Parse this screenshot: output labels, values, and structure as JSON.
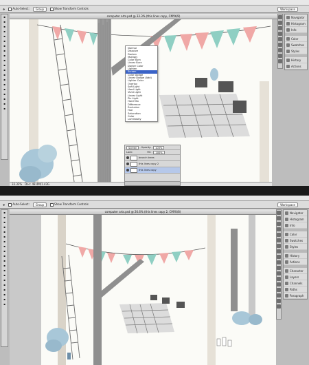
{
  "top": {
    "options_bar": {
      "auto_select_label": "Auto-Select:",
      "auto_select_value": "Group",
      "transform_label": "Show Transform Controls",
      "workspace_label": "Workspace"
    },
    "doc_title": "computer arts.psd @ 33.3% (this lines copy, CMYK/8)",
    "status_zoom": "33.33%",
    "status_doc": "Doc: 48.4M/1.43G",
    "blend_modes": [
      {
        "label": "Normal"
      },
      {
        "label": "Dissolve"
      },
      {
        "gap": true
      },
      {
        "label": "Darken"
      },
      {
        "label": "Multiply"
      },
      {
        "label": "Color Burn"
      },
      {
        "label": "Linear Burn"
      },
      {
        "label": "Darker Color"
      },
      {
        "gap": true
      },
      {
        "label": "Lighten"
      },
      {
        "label": "Screen",
        "selected": true
      },
      {
        "label": "Color Dodge"
      },
      {
        "label": "Linear Dodge (Add)"
      },
      {
        "label": "Lighter Color"
      },
      {
        "gap": true
      },
      {
        "label": "Overlay"
      },
      {
        "label": "Soft Light"
      },
      {
        "label": "Hard Light"
      },
      {
        "label": "Vivid Light"
      },
      {
        "label": "Linear Light"
      },
      {
        "label": "Pin Light"
      },
      {
        "label": "Hard Mix"
      },
      {
        "gap": true
      },
      {
        "label": "Difference"
      },
      {
        "label": "Exclusion"
      },
      {
        "gap": true
      },
      {
        "label": "Hue"
      },
      {
        "label": "Saturation"
      },
      {
        "label": "Color"
      },
      {
        "label": "Luminosity"
      }
    ],
    "layers": {
      "blend_value": "Screen",
      "opacity_label": "Opacity:",
      "opacity_value": "100%",
      "lock_label": "Lock:",
      "fill_label": "Fill:",
      "fill_value": "100%",
      "rows": [
        {
          "name": "branch trees"
        },
        {
          "name": "this lines copy 2"
        },
        {
          "name": "this lines copy",
          "selected": true
        }
      ]
    },
    "dock": [
      {
        "label": "Navigator"
      },
      {
        "label": "Histogram"
      },
      {
        "label": "Info"
      },
      {
        "sep": true
      },
      {
        "label": "Color"
      },
      {
        "label": "Swatches"
      },
      {
        "label": "Styles"
      },
      {
        "sep": true
      },
      {
        "label": "History"
      },
      {
        "label": "Actions"
      }
    ]
  },
  "bottom": {
    "options_bar": {
      "auto_select_label": "Auto-Select:",
      "auto_select_value": "Group",
      "transform_label": "Show Transform Controls",
      "workspace_label": "Workspace"
    },
    "doc_title": "computer arts.psd @ 26.6% (this lines copy 2, CMYK/8)",
    "dock": [
      {
        "label": "Navigator"
      },
      {
        "label": "Histogram"
      },
      {
        "label": "Info"
      },
      {
        "sep": true
      },
      {
        "label": "Color"
      },
      {
        "label": "Swatches"
      },
      {
        "label": "Styles"
      },
      {
        "sep": true
      },
      {
        "label": "History"
      },
      {
        "label": "Actions"
      },
      {
        "sep": true
      },
      {
        "label": "Character"
      },
      {
        "label": "Layers"
      },
      {
        "label": "Channels"
      },
      {
        "label": "Paths"
      },
      {
        "label": "Paragraph"
      }
    ]
  },
  "tools": [
    "move",
    "marquee",
    "lasso",
    "wand",
    "crop",
    "eyedropper",
    "heal",
    "brush",
    "stamp",
    "history-brush",
    "eraser",
    "gradient",
    "blur",
    "dodge",
    "pen",
    "type",
    "path-select",
    "shape",
    "hand",
    "zoom"
  ],
  "colors": {
    "pink": "#f0a8a6",
    "mint": "#8fcfc3",
    "trunk": "#8f8f8f",
    "trunk_light": "#d9d3c8",
    "ladder": "#6e6e6e",
    "bush": "#a8c7d8",
    "grid": "#7a7a7a",
    "menu_highlight": "#3a63c7"
  }
}
